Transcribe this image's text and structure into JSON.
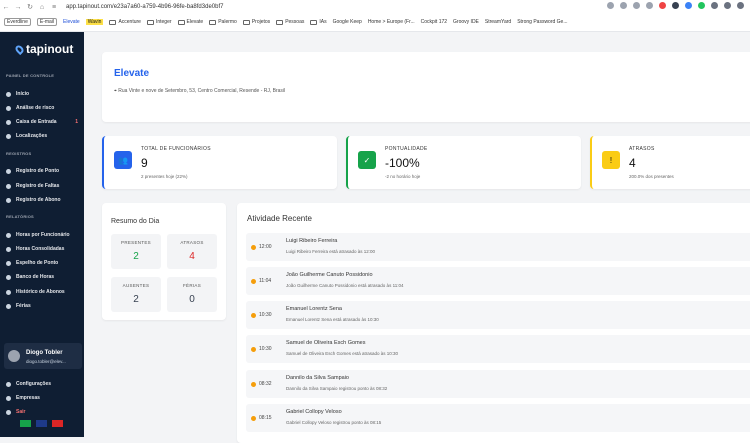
{
  "browser": {
    "url": "app.tapinout.com/e23a7a60-a759-4b96-96fe-ba8fd3de0bf7",
    "bookmarks": [
      {
        "label": "Everdline",
        "style": "box"
      },
      {
        "label": "E-mail",
        "style": "box"
      },
      {
        "label": "Elevate",
        "style": "blue"
      },
      {
        "label": "Wavin",
        "style": "wavin"
      },
      {
        "label": "Accenture",
        "style": "folder"
      },
      {
        "label": "Integer",
        "style": "folder"
      },
      {
        "label": "Elevate",
        "style": "folder"
      },
      {
        "label": "Palermo",
        "style": "folder"
      },
      {
        "label": "Projetos",
        "style": "folder"
      },
      {
        "label": "Pessoas",
        "style": "folder"
      },
      {
        "label": "IAs",
        "style": "folder"
      },
      {
        "label": "Google Keep",
        "style": "plain"
      },
      {
        "label": "Home > Europe (Fr...",
        "style": "plain"
      },
      {
        "label": "Cockpit 172",
        "style": "plain"
      },
      {
        "label": "Groovy IDE",
        "style": "plain"
      },
      {
        "label": "StreamYard",
        "style": "plain"
      },
      {
        "label": "Strong Password Ge...",
        "style": "plain"
      }
    ]
  },
  "sidebar": {
    "logo": "tapinout",
    "sections": {
      "painel": "PAINEL DE CONTROLE",
      "registros": "REGISTROS",
      "relatorios": "RELATÓRIOS"
    },
    "items": [
      {
        "label": "Início",
        "icon": "home-icon"
      },
      {
        "label": "Análise de risco",
        "icon": "chart-icon"
      },
      {
        "label": "Caixa de Entrada",
        "icon": "inbox-icon",
        "badge": "1"
      },
      {
        "label": "Localizações",
        "icon": "map-pin-icon"
      },
      {
        "label": "Registro de Ponto",
        "icon": "clock-icon"
      },
      {
        "label": "Registro de Faltas",
        "icon": "calendar-x-icon"
      },
      {
        "label": "Registro de Abono",
        "icon": "plus-circle-icon"
      },
      {
        "label": "Horas por Funcionário",
        "icon": "user-clock-icon"
      },
      {
        "label": "Horas Consolidadas",
        "icon": "table-icon"
      },
      {
        "label": "Espelho de Ponto",
        "icon": "document-icon"
      },
      {
        "label": "Banco de Horas",
        "icon": "bank-icon"
      },
      {
        "label": "Histórico de Abonos",
        "icon": "history-icon"
      },
      {
        "label": "Férias",
        "icon": "beach-icon"
      }
    ],
    "user": {
      "name": "Diogo Tobler",
      "email": "diogo.tobler@elev..."
    },
    "bottom": [
      {
        "label": "Configurações",
        "icon": "gear-icon"
      },
      {
        "label": "Empresas",
        "icon": "building-icon"
      },
      {
        "label": "Sair",
        "icon": "logout-icon",
        "color": "#f87171"
      }
    ]
  },
  "header": {
    "title": "Elevate",
    "address": "Rua Vinte e nove de Setembro, 53, Centro Comercial, Resende - RJ, Brasil"
  },
  "stats": [
    {
      "label": "TOTAL DE FUNCIONÁRIOS",
      "value": "9",
      "sub": "2 presentes hoje (22%)",
      "color": "#2563eb",
      "border": "#2563eb",
      "icon": "users-icon"
    },
    {
      "label": "PONTUALIDADE",
      "value": "-100%",
      "sub": "-2 no horário hoje",
      "color": "#16a34a",
      "border": "#16a34a",
      "icon": "check-icon"
    },
    {
      "label": "ATRASOS",
      "value": "4",
      "sub": "200.0% dos presentes",
      "color": "#facc15",
      "border": "#facc15",
      "icon": "warning-icon"
    }
  ],
  "summary": {
    "title": "Resumo do Dia",
    "items": [
      {
        "label": "PRESENTES",
        "value": "2",
        "color": "#16a34a"
      },
      {
        "label": "ATRASOS",
        "value": "4",
        "color": "#dc2626"
      },
      {
        "label": "AUSENTES",
        "value": "2",
        "color": "#374151"
      },
      {
        "label": "FÉRIAS",
        "value": "0",
        "color": "#374151"
      }
    ]
  },
  "activity": {
    "title": "Atividade Recente",
    "items": [
      {
        "time": "12:00",
        "name": "Luigi Ribeiro Ferreira",
        "desc": "Luigi Ribeiro Ferreira está atrasado às 12:00"
      },
      {
        "time": "11:04",
        "name": "João Guilherme Canuto Possidonio",
        "desc": "João Guilherme Canuto Possidonio está atrasado às 11:04"
      },
      {
        "time": "10:30",
        "name": "Emanuel Lorentz Sena",
        "desc": "Emanuel Lorentz Sena está atrasado às 10:30"
      },
      {
        "time": "10:30",
        "name": "Samuel de Oliveira Esch Gomes",
        "desc": "Samuel de Oliveira Esch Gomes está atrasado às 10:30"
      },
      {
        "time": "08:32",
        "name": "Dannilo da Silva Sampaio",
        "desc": "Dannilo da Silva Sampaio registrou ponto às 08:32"
      },
      {
        "time": "08:15",
        "name": "Gabriel Collopy Veloso",
        "desc": "Gabriel Collopy Veloso registrou ponto às 08:15"
      }
    ]
  }
}
